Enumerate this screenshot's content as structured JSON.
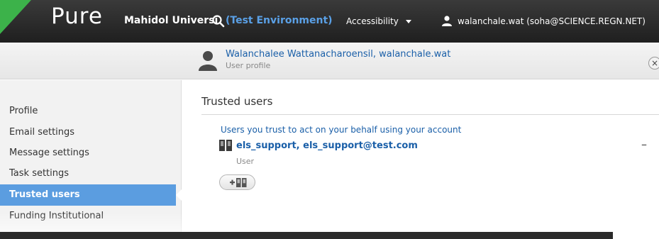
{
  "topbar": {
    "logo": "Pure",
    "org": "Mahidol Universi",
    "environment": "(Test Environment)",
    "accessibility": "Accessibility",
    "user": "walanchale.wat (soha@SCIENCE.REGN.NET)",
    "accent_green": "#3cb24a"
  },
  "profile": {
    "name": "Walanchalee Wattanacharoensil, walanchale.wat",
    "subtitle": "User profile",
    "close": "×"
  },
  "sidebar": {
    "items": [
      {
        "label": "Profile",
        "active": false
      },
      {
        "label": "Email settings",
        "active": false
      },
      {
        "label": "Message settings",
        "active": false
      },
      {
        "label": "Task settings",
        "active": false
      },
      {
        "label": "Trusted users",
        "active": true
      },
      {
        "label": "Funding Institutional",
        "active": false
      }
    ],
    "active_color": "#5b9de0"
  },
  "main": {
    "title": "Trusted users",
    "description": "Users you trust to act on your behalf using your account",
    "trusted_users": [
      {
        "name": "els_support, els_support@test.com",
        "role": "User",
        "remove": "–"
      }
    ],
    "add_icon": "add-user-icon"
  }
}
